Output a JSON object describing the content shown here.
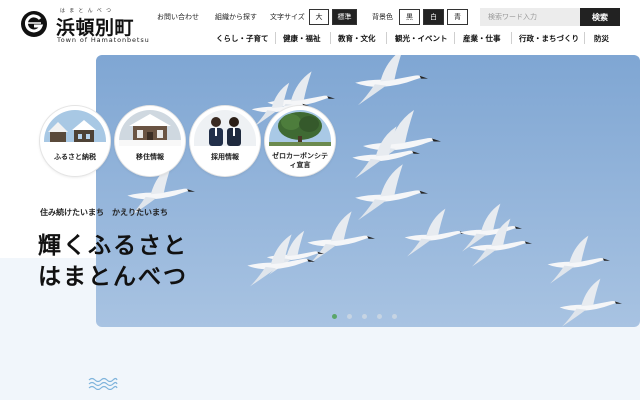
{
  "header": {
    "logo": {
      "ruby": "はまとんべつ",
      "name": "浜頓別町",
      "name_en": "Town of Hamatonbetsu"
    },
    "utility": {
      "contact": "お問い合わせ",
      "org_search": "組織から探す",
      "font_size_label": "文字サイズ",
      "font_sizes": [
        "大",
        "標準"
      ],
      "bg_color_label": "背景色",
      "bg_colors": [
        "黒",
        "白",
        "青"
      ]
    },
    "search": {
      "placeholder": "検索ワード入力",
      "button": "検索"
    },
    "nav": [
      "くらし・子育て",
      "健康・福祉",
      "教育・文化",
      "観光・イベント",
      "産業・仕事",
      "行政・まちづくり",
      "防災"
    ]
  },
  "hero": {
    "catchcopy": "住み続けたいまち　かえりたいまち",
    "title_line1": "輝くふるさと",
    "title_line2": "はまとんべつ",
    "slides": 5,
    "active_slide": 1,
    "sky_color": "#8fb2d8"
  },
  "quick_links": [
    {
      "label": "ふるさと納税",
      "icon": "houses-photo"
    },
    {
      "label": "移住情報",
      "icon": "snow-house-photo"
    },
    {
      "label": "採用情報",
      "icon": "staff-photo"
    },
    {
      "label": "ゼロカーボンシティ宣言",
      "label_line1": "ゼロカーボンシテ",
      "label_line2": "ィ宣言",
      "icon": "tree-photo"
    }
  ],
  "colors": {
    "accent": "#222222",
    "active_dot": "#5aa66a",
    "band": "#f1f6fb"
  }
}
